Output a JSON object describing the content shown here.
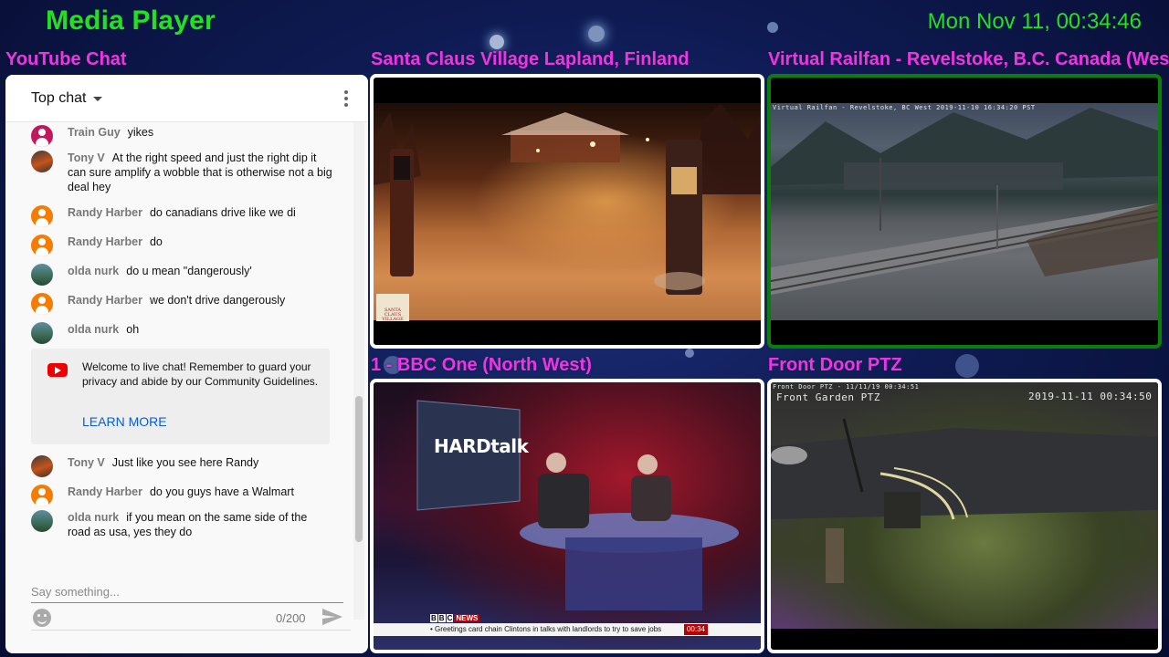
{
  "app": {
    "title": "Media Player",
    "clock": "Mon Nov 11, 00:34:46"
  },
  "chat_panel": {
    "label": "YouTube Chat",
    "mode": "Top chat",
    "messages": [
      {
        "author": "Train Guy",
        "text": "yikes",
        "avatar": "pink-person"
      },
      {
        "author": "Tony V",
        "text": "At the right speed and just the right dip it can sure amplify a wobble that is otherwise not a big deal hey",
        "avatar": "train-photo"
      },
      {
        "author": "Randy Harber",
        "text": "do canadians drive like we di",
        "avatar": "orange-person"
      },
      {
        "author": "Randy Harber",
        "text": "do",
        "avatar": "orange-person"
      },
      {
        "author": "olda nurk",
        "text": "do u mean \"dangerously'",
        "avatar": "landscape-photo"
      },
      {
        "author": "Randy Harber",
        "text": "we don't drive dangerously",
        "avatar": "orange-person"
      },
      {
        "author": "olda nurk",
        "text": "oh",
        "avatar": "landscape-photo"
      },
      {
        "author": "Tony V",
        "text": "Just like you see here Randy",
        "avatar": "train-photo"
      },
      {
        "author": "Randy Harber",
        "text": "do you guys have a Walmart",
        "avatar": "orange-person"
      },
      {
        "author": "olda nurk",
        "text": "if you mean on the same side of the road as usa, yes they do",
        "avatar": "landscape-photo"
      }
    ],
    "welcome": {
      "text": "Welcome to live chat! Remember to guard your privacy and abide by our Community Guidelines.",
      "link_label": "LEARN MORE"
    },
    "input": {
      "placeholder": "Say something...",
      "counter": "0/200"
    }
  },
  "streams": [
    {
      "label": "Santa Claus Village Lapland, Finland",
      "logo_text": "SANTA CLAUS VILLAGE"
    },
    {
      "label": "Virtual Railfan - Revelstoke, B.C. Canada (West)",
      "overlay": "Virtual Railfan - Revelstoke, BC West 2019-11-10 16:34:20 PST"
    },
    {
      "label": "1 - BBC One (North West)",
      "show": "HARDtalk",
      "bbc": [
        "B",
        "B",
        "C"
      ],
      "news_tag": "NEWS",
      "ticker": "• Greetings card chain Clintons in talks with landlords to try to save jobs",
      "ticker_time": "00:34"
    },
    {
      "label": "Front Door PTZ",
      "overlay_small": "Front Door PTZ - 11/11/19 00:34:51",
      "overlay_name": "Front Garden PTZ",
      "overlay_time": "2019-11-11  00:34:50"
    }
  ],
  "colors": {
    "accent_green": "#22e022",
    "label_magenta": "#ee33ee",
    "active_border": "#0a7d0a",
    "link_blue": "#065fd4"
  }
}
